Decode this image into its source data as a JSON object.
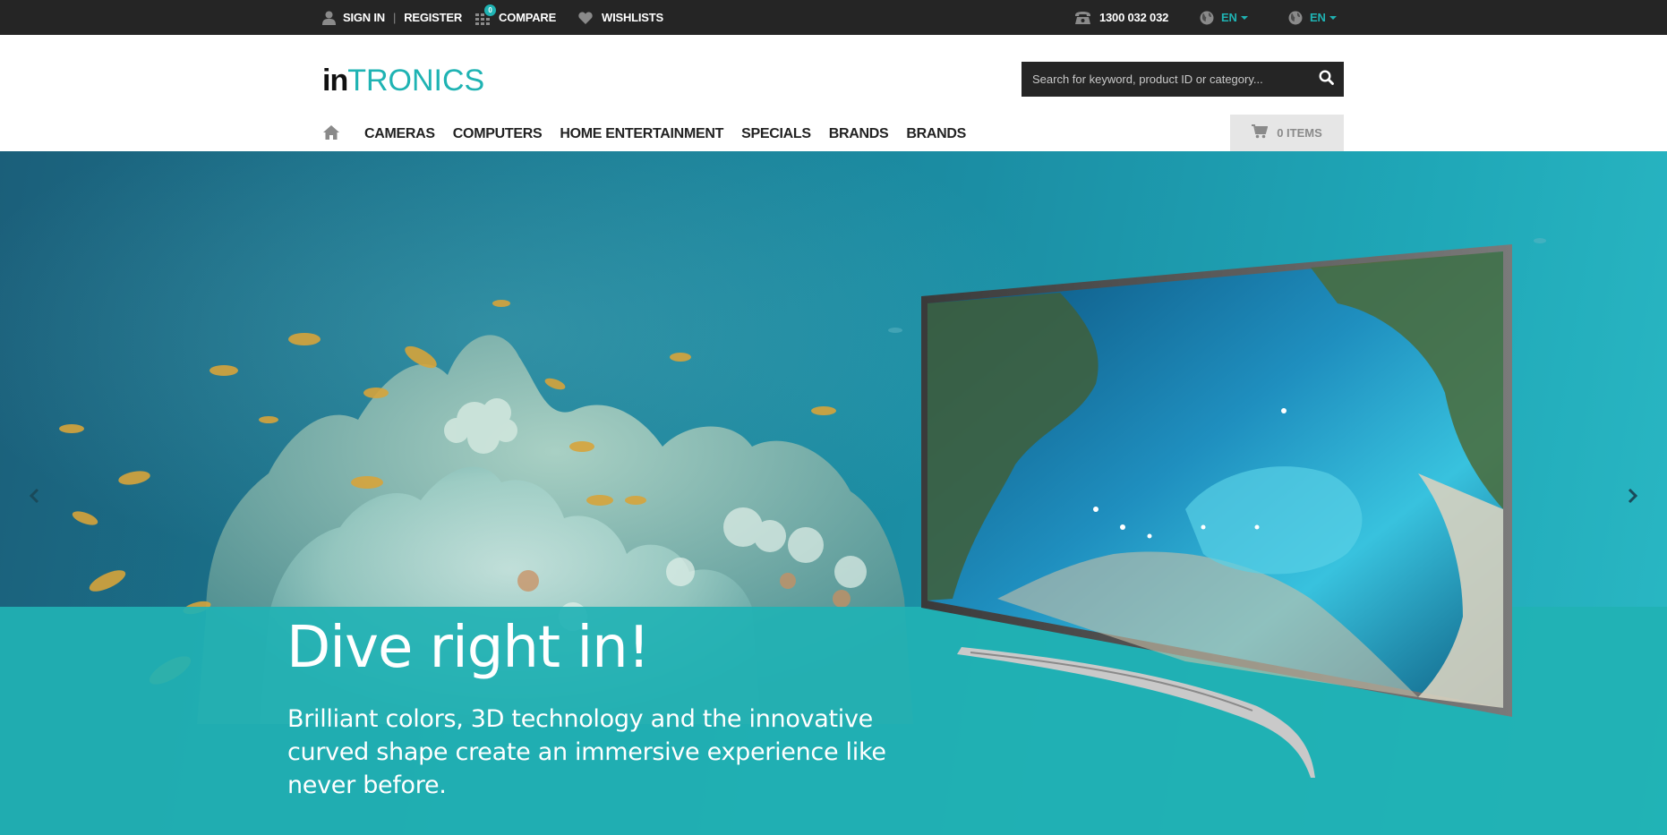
{
  "topbar": {
    "sign_in": "SIGN IN",
    "separator": "|",
    "register": "REGISTER",
    "compare": "COMPARE",
    "compare_count": "0",
    "wishlists": "WISHLISTS",
    "phone": "1300 032 032",
    "language_1": "EN",
    "language_2": "EN"
  },
  "header": {
    "logo_bold": "in",
    "logo_light": "TRONICS",
    "search_placeholder": "Search for keyword, product ID or category..."
  },
  "nav": {
    "items": [
      "CAMERAS",
      "COMPUTERS",
      "HOME ENTERTAINMENT",
      "SPECIALS",
      "BRANDS",
      "BRANDS"
    ]
  },
  "cart": {
    "label": "0 ITEMS"
  },
  "hero": {
    "title": "Dive right in!",
    "text": "Brilliant colors, 3D technology and the innovative curved shape create an immersive experience like never before."
  },
  "colors": {
    "accent": "#1fb3b3",
    "topbar": "#252525",
    "band": "#21b2b4"
  },
  "icons": [
    "user-icon",
    "compare-icon",
    "heart-icon",
    "phone-icon",
    "globe-icon",
    "search-icon",
    "home-icon",
    "cart-icon",
    "chevron-left-icon",
    "chevron-right-icon"
  ]
}
